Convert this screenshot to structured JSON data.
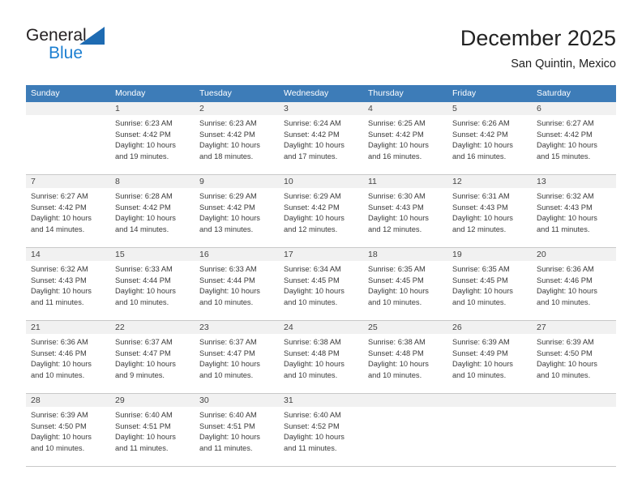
{
  "brand": {
    "name_top": "General",
    "name_bottom": "Blue",
    "triangle_icon": "triangle-icon",
    "accent_color": "#1c7fd1"
  },
  "header": {
    "title": "December 2025",
    "subtitle": "San Quintin, Mexico"
  },
  "colors": {
    "header_row_bg": "#3d7cb8",
    "header_row_text": "#ffffff",
    "daynum_band_bg": "#f1f1f1",
    "cell_bg": "#ffffff",
    "grid_line": "#c8c8c8",
    "body_text": "#3a3a3a"
  },
  "weekdays": [
    "Sunday",
    "Monday",
    "Tuesday",
    "Wednesday",
    "Thursday",
    "Friday",
    "Saturday"
  ],
  "weeks": [
    [
      {
        "day": ""
      },
      {
        "day": "1",
        "sunrise": "Sunrise: 6:23 AM",
        "sunset": "Sunset: 4:42 PM",
        "daylight": "Daylight: 10 hours and 19 minutes."
      },
      {
        "day": "2",
        "sunrise": "Sunrise: 6:23 AM",
        "sunset": "Sunset: 4:42 PM",
        "daylight": "Daylight: 10 hours and 18 minutes."
      },
      {
        "day": "3",
        "sunrise": "Sunrise: 6:24 AM",
        "sunset": "Sunset: 4:42 PM",
        "daylight": "Daylight: 10 hours and 17 minutes."
      },
      {
        "day": "4",
        "sunrise": "Sunrise: 6:25 AM",
        "sunset": "Sunset: 4:42 PM",
        "daylight": "Daylight: 10 hours and 16 minutes."
      },
      {
        "day": "5",
        "sunrise": "Sunrise: 6:26 AM",
        "sunset": "Sunset: 4:42 PM",
        "daylight": "Daylight: 10 hours and 16 minutes."
      },
      {
        "day": "6",
        "sunrise": "Sunrise: 6:27 AM",
        "sunset": "Sunset: 4:42 PM",
        "daylight": "Daylight: 10 hours and 15 minutes."
      }
    ],
    [
      {
        "day": "7",
        "sunrise": "Sunrise: 6:27 AM",
        "sunset": "Sunset: 4:42 PM",
        "daylight": "Daylight: 10 hours and 14 minutes."
      },
      {
        "day": "8",
        "sunrise": "Sunrise: 6:28 AM",
        "sunset": "Sunset: 4:42 PM",
        "daylight": "Daylight: 10 hours and 14 minutes."
      },
      {
        "day": "9",
        "sunrise": "Sunrise: 6:29 AM",
        "sunset": "Sunset: 4:42 PM",
        "daylight": "Daylight: 10 hours and 13 minutes."
      },
      {
        "day": "10",
        "sunrise": "Sunrise: 6:29 AM",
        "sunset": "Sunset: 4:42 PM",
        "daylight": "Daylight: 10 hours and 12 minutes."
      },
      {
        "day": "11",
        "sunrise": "Sunrise: 6:30 AM",
        "sunset": "Sunset: 4:43 PM",
        "daylight": "Daylight: 10 hours and 12 minutes."
      },
      {
        "day": "12",
        "sunrise": "Sunrise: 6:31 AM",
        "sunset": "Sunset: 4:43 PM",
        "daylight": "Daylight: 10 hours and 12 minutes."
      },
      {
        "day": "13",
        "sunrise": "Sunrise: 6:32 AM",
        "sunset": "Sunset: 4:43 PM",
        "daylight": "Daylight: 10 hours and 11 minutes."
      }
    ],
    [
      {
        "day": "14",
        "sunrise": "Sunrise: 6:32 AM",
        "sunset": "Sunset: 4:43 PM",
        "daylight": "Daylight: 10 hours and 11 minutes."
      },
      {
        "day": "15",
        "sunrise": "Sunrise: 6:33 AM",
        "sunset": "Sunset: 4:44 PM",
        "daylight": "Daylight: 10 hours and 10 minutes."
      },
      {
        "day": "16",
        "sunrise": "Sunrise: 6:33 AM",
        "sunset": "Sunset: 4:44 PM",
        "daylight": "Daylight: 10 hours and 10 minutes."
      },
      {
        "day": "17",
        "sunrise": "Sunrise: 6:34 AM",
        "sunset": "Sunset: 4:45 PM",
        "daylight": "Daylight: 10 hours and 10 minutes."
      },
      {
        "day": "18",
        "sunrise": "Sunrise: 6:35 AM",
        "sunset": "Sunset: 4:45 PM",
        "daylight": "Daylight: 10 hours and 10 minutes."
      },
      {
        "day": "19",
        "sunrise": "Sunrise: 6:35 AM",
        "sunset": "Sunset: 4:45 PM",
        "daylight": "Daylight: 10 hours and 10 minutes."
      },
      {
        "day": "20",
        "sunrise": "Sunrise: 6:36 AM",
        "sunset": "Sunset: 4:46 PM",
        "daylight": "Daylight: 10 hours and 10 minutes."
      }
    ],
    [
      {
        "day": "21",
        "sunrise": "Sunrise: 6:36 AM",
        "sunset": "Sunset: 4:46 PM",
        "daylight": "Daylight: 10 hours and 10 minutes."
      },
      {
        "day": "22",
        "sunrise": "Sunrise: 6:37 AM",
        "sunset": "Sunset: 4:47 PM",
        "daylight": "Daylight: 10 hours and 9 minutes."
      },
      {
        "day": "23",
        "sunrise": "Sunrise: 6:37 AM",
        "sunset": "Sunset: 4:47 PM",
        "daylight": "Daylight: 10 hours and 10 minutes."
      },
      {
        "day": "24",
        "sunrise": "Sunrise: 6:38 AM",
        "sunset": "Sunset: 4:48 PM",
        "daylight": "Daylight: 10 hours and 10 minutes."
      },
      {
        "day": "25",
        "sunrise": "Sunrise: 6:38 AM",
        "sunset": "Sunset: 4:48 PM",
        "daylight": "Daylight: 10 hours and 10 minutes."
      },
      {
        "day": "26",
        "sunrise": "Sunrise: 6:39 AM",
        "sunset": "Sunset: 4:49 PM",
        "daylight": "Daylight: 10 hours and 10 minutes."
      },
      {
        "day": "27",
        "sunrise": "Sunrise: 6:39 AM",
        "sunset": "Sunset: 4:50 PM",
        "daylight": "Daylight: 10 hours and 10 minutes."
      }
    ],
    [
      {
        "day": "28",
        "sunrise": "Sunrise: 6:39 AM",
        "sunset": "Sunset: 4:50 PM",
        "daylight": "Daylight: 10 hours and 10 minutes."
      },
      {
        "day": "29",
        "sunrise": "Sunrise: 6:40 AM",
        "sunset": "Sunset: 4:51 PM",
        "daylight": "Daylight: 10 hours and 11 minutes."
      },
      {
        "day": "30",
        "sunrise": "Sunrise: 6:40 AM",
        "sunset": "Sunset: 4:51 PM",
        "daylight": "Daylight: 10 hours and 11 minutes."
      },
      {
        "day": "31",
        "sunrise": "Sunrise: 6:40 AM",
        "sunset": "Sunset: 4:52 PM",
        "daylight": "Daylight: 10 hours and 11 minutes."
      },
      {
        "day": ""
      },
      {
        "day": ""
      },
      {
        "day": ""
      }
    ]
  ]
}
